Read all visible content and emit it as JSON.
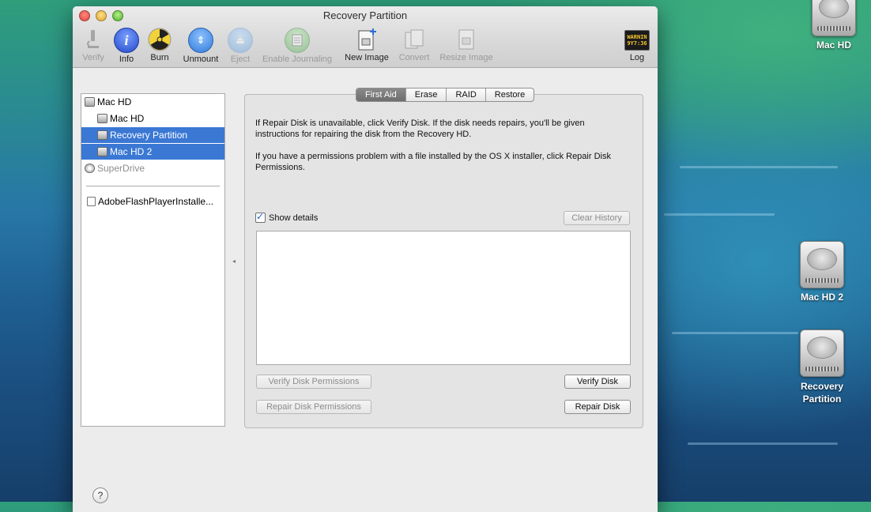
{
  "window": {
    "title": "Recovery Partition"
  },
  "toolbar": {
    "items": [
      {
        "label": "Verify",
        "icon": "microscope-icon",
        "enabled": false
      },
      {
        "label": "Info",
        "icon": "info-icon",
        "enabled": true
      },
      {
        "label": "Burn",
        "icon": "radiation-icon",
        "enabled": true
      },
      {
        "label": "Unmount",
        "icon": "unmount-icon",
        "enabled": true
      },
      {
        "label": "Eject",
        "icon": "eject-icon",
        "enabled": false
      },
      {
        "label": "Enable Journaling",
        "icon": "journal-icon",
        "enabled": false
      },
      {
        "label": "New Image",
        "icon": "new-image-icon",
        "enabled": true
      },
      {
        "label": "Convert",
        "icon": "convert-icon",
        "enabled": false
      },
      {
        "label": "Resize Image",
        "icon": "resize-image-icon",
        "enabled": false
      }
    ],
    "log": {
      "label": "Log",
      "icon_text_1": "WARNIN",
      "icon_text_2": "9Y7:36"
    }
  },
  "sidebar": {
    "items": [
      {
        "label": "Mac HD"
      },
      {
        "label": "Mac HD"
      },
      {
        "label": "Recovery Partition"
      },
      {
        "label": "Mac HD 2"
      },
      {
        "label": "SuperDrive"
      },
      {
        "label": "AdobeFlashPlayerInstalle..."
      }
    ]
  },
  "tabs": [
    "First Aid",
    "Erase",
    "RAID",
    "Restore"
  ],
  "first_aid": {
    "paragraph1": "If Repair Disk is unavailable, click Verify Disk. If the disk needs repairs, you'll be given instructions for repairing the disk from the Recovery HD.",
    "paragraph2": "If you have a permissions problem with a file installed by the OS X installer, click Repair Disk Permissions.",
    "show_details": "Show details",
    "clear_history": "Clear History",
    "verify_permissions": "Verify Disk Permissions",
    "repair_permissions": "Repair Disk Permissions",
    "verify_disk": "Verify Disk",
    "repair_disk": "Repair Disk"
  },
  "help": "?",
  "desktop": {
    "icons": [
      {
        "label": "Mac HD"
      },
      {
        "label": "Mac HD 2"
      },
      {
        "label": "Recovery Partition"
      }
    ]
  }
}
